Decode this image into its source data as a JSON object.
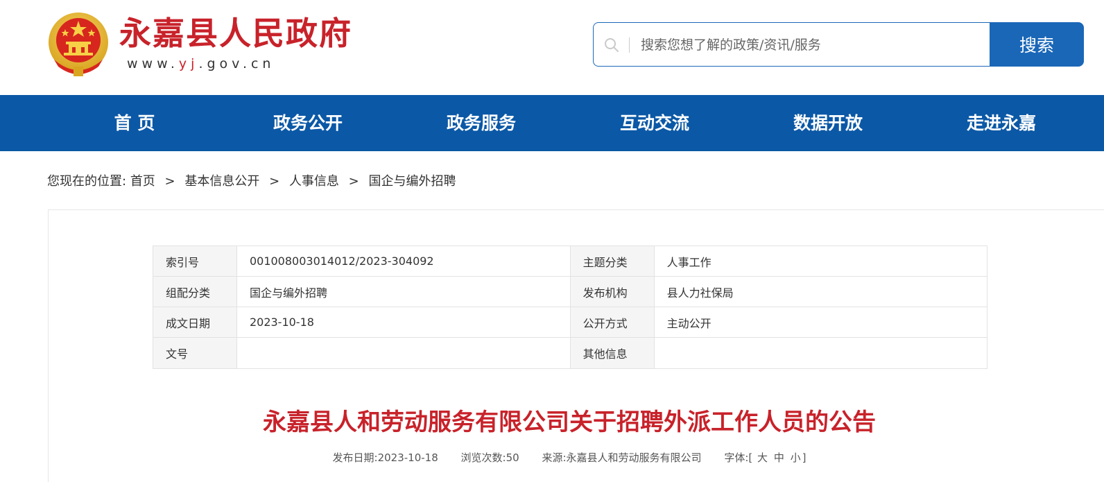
{
  "header": {
    "site_title": "永嘉县人民政府",
    "site_url_prefix": "www.",
    "site_url_highlight": "yj",
    "site_url_suffix": ".gov.cn",
    "brand_color": "#c8222a"
  },
  "search": {
    "placeholder": "搜索您想了解的政策/资讯/服务",
    "button_label": "搜索",
    "accent_color": "#1a67b8"
  },
  "nav": {
    "background": "#0b58a6",
    "items": [
      {
        "label": "首 页"
      },
      {
        "label": "政务公开"
      },
      {
        "label": "政务服务"
      },
      {
        "label": "互动交流"
      },
      {
        "label": "数据开放"
      },
      {
        "label": "走进永嘉"
      }
    ]
  },
  "breadcrumb": {
    "prefix": "您现在的位置:",
    "items": [
      "首页",
      "基本信息公开",
      "人事信息",
      "国企与编外招聘"
    ],
    "separator": ">"
  },
  "meta_table": {
    "rows": [
      {
        "k1": "索引号",
        "v1": "001008003014012/2023-304092",
        "k2": "主题分类",
        "v2": "人事工作"
      },
      {
        "k1": "组配分类",
        "v1": "国企与编外招聘",
        "k2": "发布机构",
        "v2": "县人力社保局"
      },
      {
        "k1": "成文日期",
        "v1": "2023-10-18",
        "k2": "公开方式",
        "v2": "主动公开"
      },
      {
        "k1": "文号",
        "v1": "",
        "k2": "其他信息",
        "v2": ""
      }
    ]
  },
  "article": {
    "title": "永嘉县人和劳动服务有限公司关于招聘外派工作人员的公告",
    "publish_date_label": "发布日期:",
    "publish_date": "2023-10-18",
    "views_label": "浏览次数:",
    "views": "50",
    "source_label": "来源:",
    "source": "永嘉县人和劳动服务有限公司",
    "font_label": "字体:",
    "font_open": "[",
    "font_sizes": [
      "大",
      "中",
      "小"
    ],
    "font_close": "]"
  }
}
